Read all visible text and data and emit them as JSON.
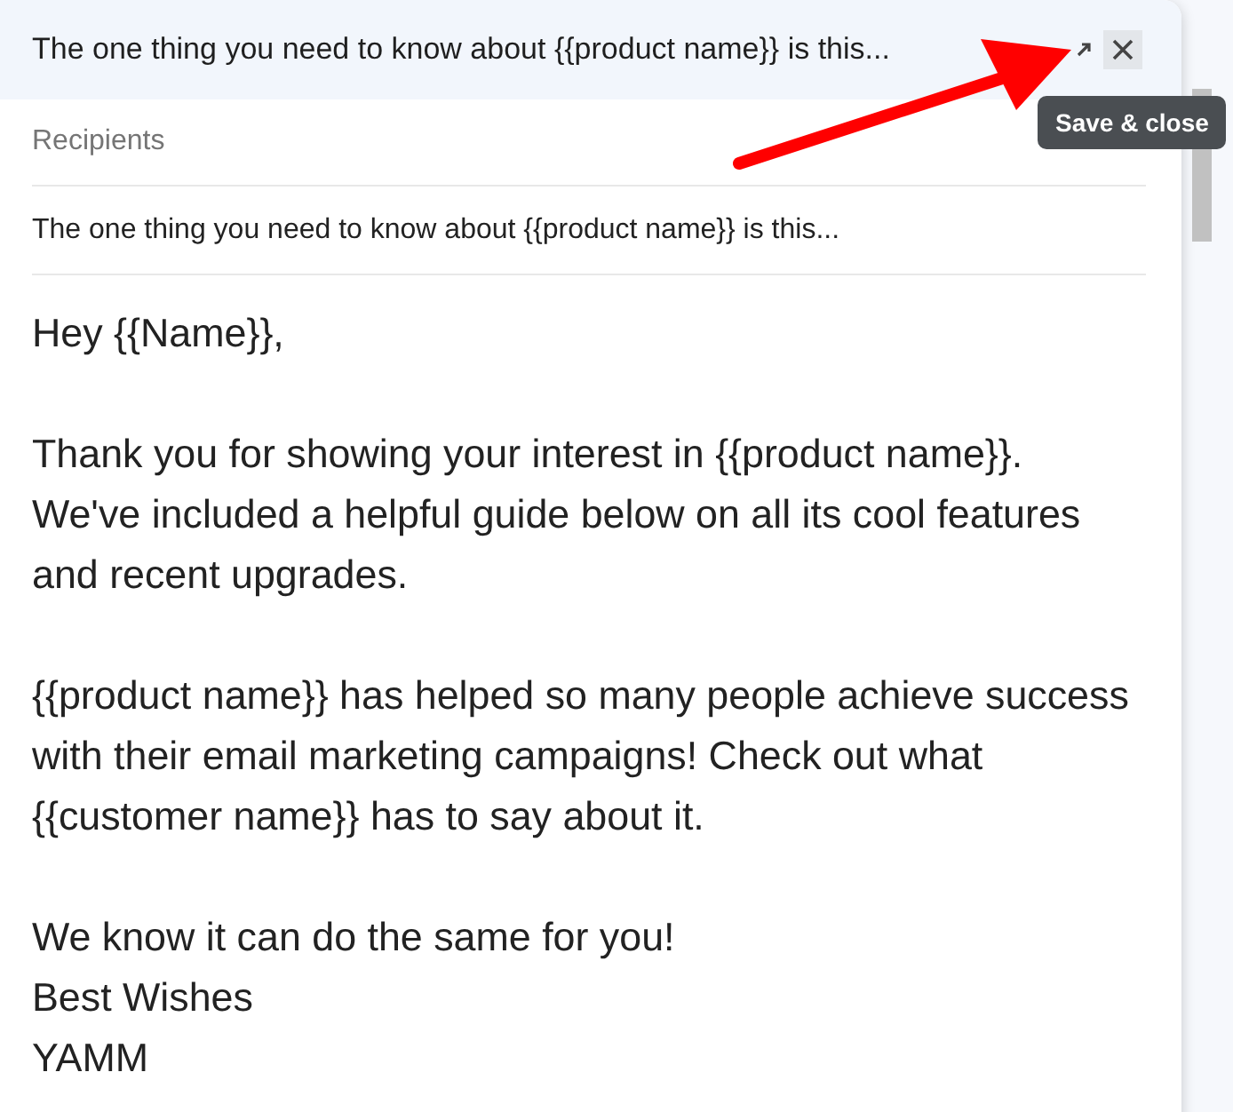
{
  "header": {
    "title": "The one thing you need to know about {{product name}} is this..."
  },
  "tooltip": "Save & close",
  "recipients": {
    "placeholder": "Recipients"
  },
  "subject": {
    "value": "The one thing you need to know about {{product name}} is this..."
  },
  "body": [
    "Hey {{Name}},",
    "Thank you for showing your interest in {{product name}}. We've included a helpful guide below on all its cool features and recent upgrades.",
    "{{product name}} has helped so many people achieve success with their email marketing campaigns! Check out what {{customer name}} has to say about it.",
    "We know it can do the same for you!\nBest Wishes\nYAMM"
  ]
}
